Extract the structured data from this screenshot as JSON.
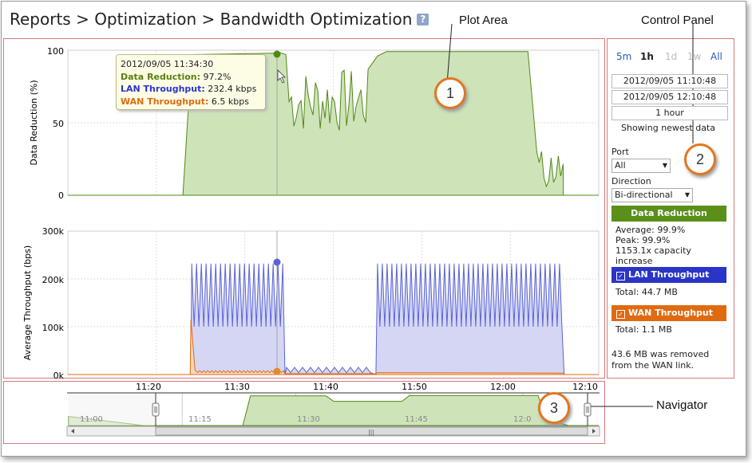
{
  "breadcrumb": {
    "text": "Reports > Optimization > Bandwidth Optimization",
    "help_icon": "?"
  },
  "callouts": {
    "plot_area": "Plot Area",
    "control_panel": "Control Panel",
    "navigator": "Navigator",
    "badge1": "1",
    "badge2": "2",
    "badge3": "3"
  },
  "colors": {
    "data_reduction": "#5a8f1a",
    "lan": "#2a35c8",
    "wan": "#e06a10",
    "frame": "#d47a7a"
  },
  "control_panel": {
    "ranges": [
      {
        "label": "5m",
        "state": "link"
      },
      {
        "label": "1h",
        "state": "active"
      },
      {
        "label": "1d",
        "state": "disabled"
      },
      {
        "label": "1w",
        "state": "disabled"
      },
      {
        "label": "All",
        "state": "link"
      }
    ],
    "start_time": "2012/09/05 11:10:48",
    "end_time": "2012/09/05 12:10:48",
    "duration": "1 hour",
    "status": "Showing newest data",
    "port_label": "Port",
    "port_value": "All",
    "direction_label": "Direction",
    "direction_value": "Bi-directional",
    "data_reduction": {
      "title": "Data Reduction",
      "average": "Average: 99.9%",
      "peak": "Peak: 99.9%",
      "capacity_1": "1153.1x capacity",
      "capacity_2": "increase"
    },
    "lan": {
      "title": "LAN Throughput",
      "total": "Total: 44.7 MB"
    },
    "wan": {
      "title": "WAN Throughput",
      "total": "Total: 1.1 MB"
    },
    "removed_1": "43.6 MB was removed",
    "removed_2": "from the WAN link."
  },
  "tooltip": {
    "time": "2012/09/05 11:34:30",
    "dr_label": "Data Reduction:",
    "dr_value": "97.2%",
    "lan_label": "LAN Throughput:",
    "lan_value": "232.4 kbps",
    "wan_label": "WAN Throughput:",
    "wan_value": "6.5 kbps"
  },
  "chart_data": [
    {
      "type": "area",
      "ylabel": "Data Reduction (%)",
      "ylim": [
        0,
        100
      ],
      "yticks": [
        "100",
        "50",
        "0"
      ],
      "series": [
        {
          "name": "Data Reduction",
          "x": [
            "11:10",
            "11:20",
            "11:23",
            "11:24",
            "11:28",
            "11:33",
            "11:34",
            "11:35",
            "11:38",
            "11:41",
            "11:44",
            "11:45",
            "11:46",
            "11:50",
            "11:55",
            "12:00",
            "12:02",
            "12:03",
            "12:04",
            "12:06",
            "12:06",
            "12:10"
          ],
          "values": [
            0,
            0,
            0,
            97,
            98,
            99,
            97,
            60,
            60,
            55,
            62,
            90,
            99,
            99,
            99,
            99,
            99,
            30,
            20,
            20,
            0,
            0
          ]
        }
      ]
    },
    {
      "type": "area",
      "ylabel": "Average Throughput (bps)",
      "ylim": [
        0,
        300000
      ],
      "yticks": [
        "300k",
        "200k",
        "100k",
        "0k"
      ],
      "series": [
        {
          "name": "LAN Throughput",
          "x": [
            "11:10",
            "11:23",
            "11:24",
            "11:34",
            "11:35",
            "11:44",
            "11:45",
            "12:06",
            "12:07",
            "12:10"
          ],
          "values": [
            0,
            0,
            230000,
            230000,
            15000,
            15000,
            230000,
            230000,
            0,
            0
          ]
        },
        {
          "name": "WAN Throughput",
          "x": [
            "11:10",
            "11:23",
            "11:24",
            "11:25",
            "11:34",
            "11:35",
            "11:44",
            "11:45",
            "12:06",
            "12:10"
          ],
          "values": [
            0,
            0,
            115000,
            8000,
            6500,
            1000,
            1000,
            3000,
            3000,
            0
          ]
        }
      ]
    },
    {
      "type": "area",
      "title": "navigator",
      "xticks_top": [
        "11:20",
        "11:30",
        "11:40",
        "11:50",
        "12:00",
        "12:10"
      ],
      "xticks_inner": [
        "11:00",
        "11:15",
        "11:30",
        "11:45",
        "12:0"
      ],
      "series": [
        {
          "name": "Data Reduction",
          "x": [
            "11:00",
            "11:10",
            "11:23",
            "11:24",
            "11:34",
            "11:35",
            "11:44",
            "11:45",
            "12:02",
            "12:03",
            "12:06"
          ],
          "values": [
            30,
            0,
            0,
            98,
            98,
            80,
            80,
            99,
            99,
            20,
            0
          ]
        }
      ],
      "scrollbar_grip": "|||"
    }
  ]
}
